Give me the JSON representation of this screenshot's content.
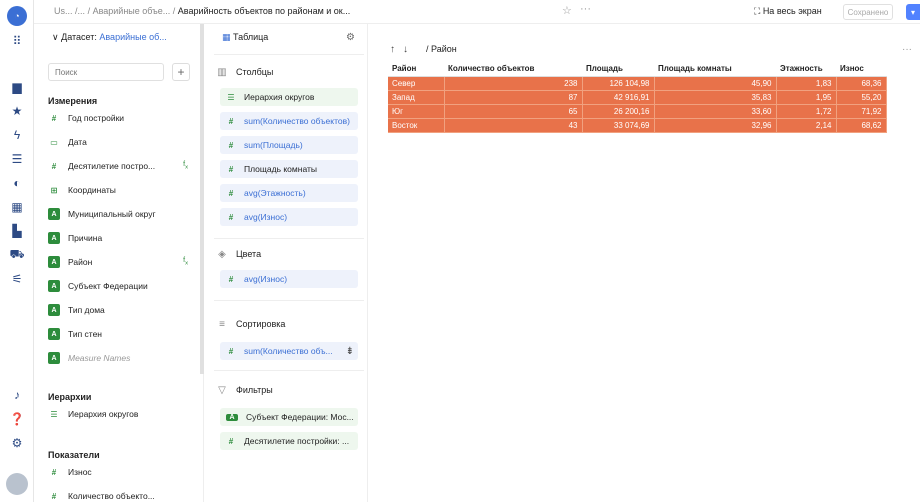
{
  "breadcrumbs": {
    "parts": [
      "Us...",
      "/...",
      "Аварийные объе...",
      "Аварийность объектов по районам и ок..."
    ]
  },
  "topbar": {
    "fullscreen_label": "На весь экран",
    "saved_label": "Сохранено"
  },
  "dataset": {
    "prefix": "Датасет:",
    "name": "Аварийные об...",
    "search_placeholder": "Поиск"
  },
  "sections": {
    "dimensions": "Измерения",
    "hierarchies": "Иерархии",
    "measures": "Показатели"
  },
  "dimensions": [
    {
      "icon": "number",
      "label": "Год постройки"
    },
    {
      "icon": "calendar",
      "label": "Дата"
    },
    {
      "icon": "number",
      "label": "Десятилетие постро..."
    },
    {
      "icon": "geo",
      "label": "Координаты"
    },
    {
      "icon": "string",
      "label": "Муниципальный округ"
    },
    {
      "icon": "string",
      "label": "Причина"
    },
    {
      "icon": "string",
      "label": "Район"
    },
    {
      "icon": "string",
      "label": "Субъект Федерации"
    },
    {
      "icon": "string",
      "label": "Тип дома"
    },
    {
      "icon": "string",
      "label": "Тип стен"
    },
    {
      "icon": "string",
      "label": "Measure Names"
    }
  ],
  "hierarchy_items": [
    {
      "label": "Иерархия округов"
    }
  ],
  "measure_items": [
    {
      "label": "Износ"
    },
    {
      "label": "Количество объекто..."
    }
  ],
  "viz": {
    "type_label": "Таблица"
  },
  "columns_box": {
    "title": "Столбцы",
    "items": [
      "Иерархия округов",
      "sum(Количество объектов)",
      "sum(Площадь)",
      "Площадь комнаты",
      "avg(Этажность)",
      "avg(Износ)"
    ]
  },
  "colors_box": {
    "title": "Цвета",
    "items": [
      "avg(Износ)"
    ]
  },
  "sort_box": {
    "title": "Сортировка",
    "items": [
      "sum(Количество объ..."
    ]
  },
  "filters_box": {
    "title": "Фильтры",
    "items": [
      "Субъект Федерации: Мос...",
      "Десятилетие постройки: ..."
    ]
  },
  "workspace": {
    "path": "/ Район"
  },
  "table": {
    "headers": [
      "Район",
      "Количество объектов",
      "Площадь",
      "Площадь комнаты",
      "Этажность",
      "Износ"
    ],
    "rows": [
      [
        "Север",
        "238",
        "126 104,98",
        "45,90",
        "1,83",
        "68,36"
      ],
      [
        "Запад",
        "87",
        "42 916,91",
        "35,83",
        "1,95",
        "55,20"
      ],
      [
        "Юг",
        "65",
        "26 200,16",
        "33,60",
        "1,72",
        "71,92"
      ],
      [
        "Восток",
        "43",
        "33 074,69",
        "32,96",
        "2,14",
        "68,62"
      ]
    ]
  }
}
